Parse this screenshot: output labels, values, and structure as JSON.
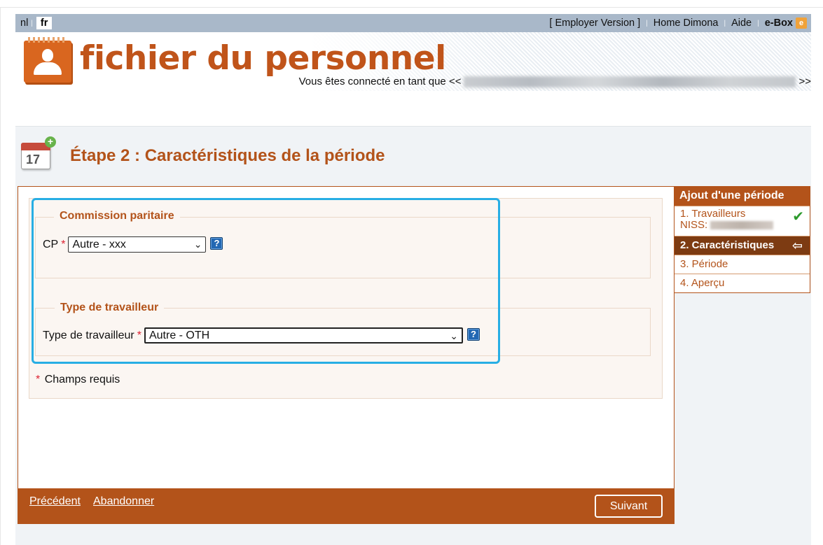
{
  "lang": {
    "nl": "nl",
    "fr": "fr"
  },
  "toplinks": {
    "employer": "[ Employer Version ]",
    "home": "Home Dimona",
    "aide": "Aide",
    "ebox": "e-Box"
  },
  "banner": {
    "title": "fichier du personnel",
    "connected_prefix": "Vous êtes connecté en tant que <<",
    "connected_suffix": ">>"
  },
  "page": {
    "step_title": "Étape 2 : Caractéristiques de la période",
    "calendar_day": "17"
  },
  "form": {
    "section1_legend": "Commission paritaire",
    "cp_label": "CP",
    "cp_value": "Autre - xxx",
    "section2_legend": "Type de travailleur",
    "worker_label": "Type de travailleur",
    "worker_value": "Autre - OTH",
    "required_mark": "*",
    "help": "?",
    "required_note": "Champs requis"
  },
  "footer": {
    "prev": "Précédent",
    "abandon": "Abandonner",
    "next": "Suivant"
  },
  "sidebar": {
    "title": "Ajout d'une période",
    "items": [
      {
        "label": "1. Travailleurs",
        "sub": "NISS:",
        "status": "done"
      },
      {
        "label": "2. Caractéristiques",
        "status": "active"
      },
      {
        "label": "3. Période"
      },
      {
        "label": "4. Aperçu"
      }
    ]
  },
  "colors": {
    "accent": "#b3531a",
    "highlight": "#27aee4",
    "topbar": "#a9b8c9"
  }
}
